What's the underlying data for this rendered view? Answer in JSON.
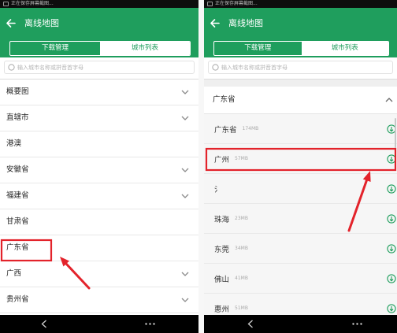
{
  "status_bar": {
    "text": "正在保存屏幕截图..."
  },
  "colors": {
    "primary_green": "#1f9e5d",
    "annotation_red": "#e3232b"
  },
  "icons": {
    "back": "back-arrow-icon",
    "search": "search-icon",
    "expand": "chevron-down-icon",
    "collapse": "chevron-up-icon",
    "download": "download-icon",
    "nav_back": "nav-back-icon",
    "nav_more": "nav-more-icon"
  },
  "left_screen": {
    "header": {
      "title": "离线地图"
    },
    "tabs": [
      {
        "label": "下载管理",
        "selected": false
      },
      {
        "label": "城市列表",
        "selected": true
      }
    ],
    "search": {
      "placeholder": "输入城市名称或拼音首字母"
    },
    "province_list": [
      {
        "label": "概要图"
      },
      {
        "label": "直辖市"
      },
      {
        "label": "港澳"
      },
      {
        "label": "安徽省"
      },
      {
        "label": "福建省"
      },
      {
        "label": "甘肃省"
      },
      {
        "label": "广东省"
      },
      {
        "label": "广西"
      },
      {
        "label": "贵州省"
      }
    ],
    "annotation": {
      "highlighted_row_index": 6
    }
  },
  "right_screen": {
    "header": {
      "title": "离线地图"
    },
    "tabs": [
      {
        "label": "下载管理",
        "selected": false
      },
      {
        "label": "城市列表",
        "selected": true
      }
    ],
    "search": {
      "placeholder": "输入城市名称或拼音首字母"
    },
    "section": {
      "label": "广东省",
      "expanded": true
    },
    "city_list": [
      {
        "name": "广东省",
        "size": "174MB"
      },
      {
        "name": "广州",
        "size": "57MB"
      },
      {
        "name": "氵",
        "size": ""
      },
      {
        "name": "珠海",
        "size": "23MB"
      },
      {
        "name": "东莞",
        "size": "34MB"
      },
      {
        "name": "佛山",
        "size": "41MB"
      },
      {
        "name": "惠州",
        "size": "51MB"
      }
    ],
    "annotation": {
      "highlighted_row_index": 1
    }
  }
}
